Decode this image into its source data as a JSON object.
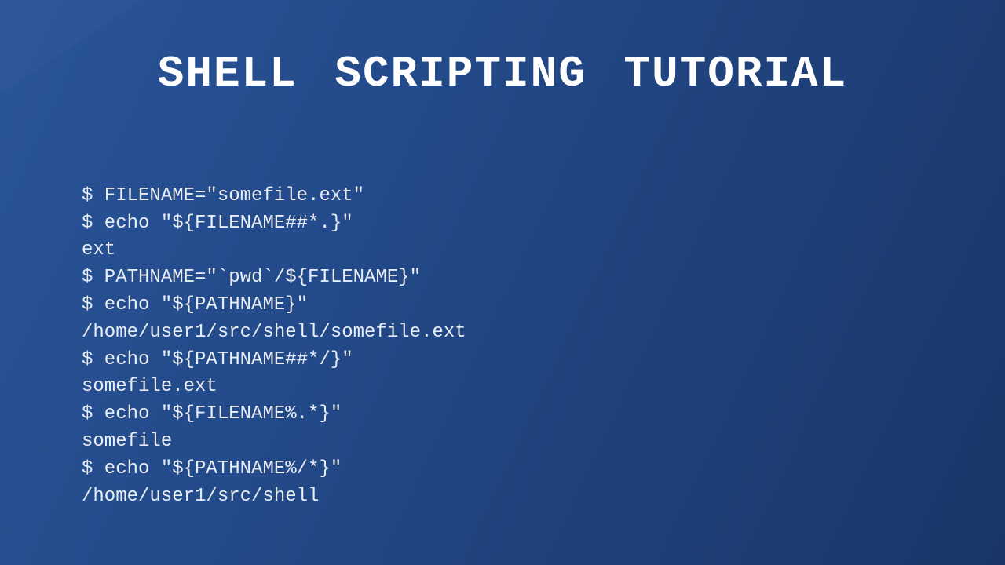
{
  "title": "SHELL SCRIPTING TUTORIAL",
  "lines": [
    "$ FILENAME=\"somefile.ext\"",
    "$ echo \"${FILENAME##*.}\"",
    "ext",
    "$ PATHNAME=\"`pwd`/${FILENAME}\"",
    "$ echo \"${PATHNAME}\"",
    "/home/user1/src/shell/somefile.ext",
    "$ echo \"${PATHNAME##*/}\"",
    "somefile.ext",
    "$ echo \"${FILENAME%.*}\"",
    "somefile",
    "$ echo \"${PATHNAME%/*}\"",
    "/home/user1/src/shell"
  ]
}
